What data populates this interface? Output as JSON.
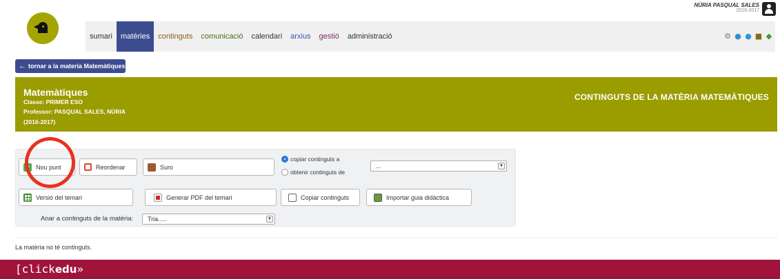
{
  "user": {
    "name": "NÚRIA PASQUAL SALES",
    "year": "2016-2017"
  },
  "nav": {
    "items": [
      {
        "label": "sumari",
        "color": "#333333"
      },
      {
        "label": "matèries",
        "color": "#ffffff",
        "active": true
      },
      {
        "label": "continguts",
        "color": "#8a5a1a"
      },
      {
        "label": "comunicació",
        "color": "#4a6a1a"
      },
      {
        "label": "calendari",
        "color": "#333333"
      },
      {
        "label": "arxius",
        "color": "#2d59b3"
      },
      {
        "label": "gestió",
        "color": "#7a2a6a"
      },
      {
        "label": "administració",
        "color": "#333333"
      }
    ],
    "active_bg": "#3d4c8e"
  },
  "tools": {
    "icons": [
      "gear-icon",
      "chat-icon",
      "user-icon",
      "group-icon",
      "leaf-icon"
    ]
  },
  "back_button": {
    "label": "tornar a la materia Matemàtiques"
  },
  "banner": {
    "subject": "Matemàtiques",
    "class_line": "Classe: PRIMER ESO",
    "teacher_line": "Professor: PASQUAL SALES, NÚRIA",
    "year_line": "(2016-2017)",
    "section_title": "CONTINGUTS DE LA MATÈRIA MATEMÀTIQUES",
    "color": "#9b9c00"
  },
  "panel": {
    "new_point": "Nou punt",
    "reorder": "Reordenar",
    "cork": "Suro",
    "syllabus_version": "Versió del temari",
    "generate_pdf": "Generar PDF del temari",
    "copy_contents": "Copiar continguts",
    "import_guide": "Importar guia didàctica",
    "radio_copy": "copiar continguts a",
    "radio_get": "obtenir continguts de",
    "target_select": "...",
    "goto_label": "Anar a continguts de la matèria:",
    "goto_select": "Tria....."
  },
  "content": {
    "empty_message": "La matèria no té continguts."
  },
  "footer": {
    "brand_bracket": "[",
    "brand_click": "click",
    "brand_edu": "edu",
    "brand_suffix": "»",
    "color": "#a0143c"
  }
}
